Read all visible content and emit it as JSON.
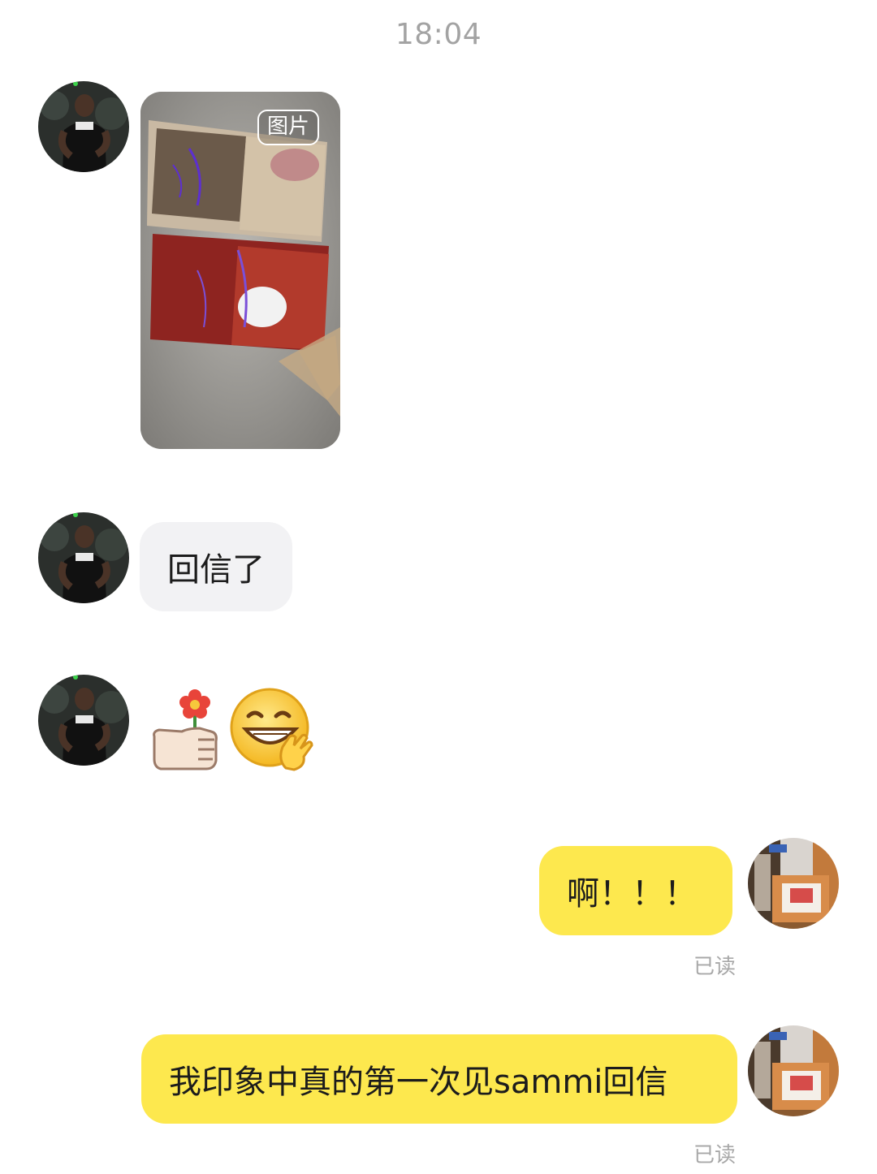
{
  "chat": {
    "timestamp": "18:04",
    "messages": [
      {
        "side": "in",
        "type": "image",
        "tag": "图片"
      },
      {
        "side": "in",
        "type": "text",
        "text": "回信了"
      },
      {
        "side": "in",
        "type": "stickers",
        "icons": [
          "thumb-flower-icon",
          "grin-wave-emoji-icon"
        ]
      },
      {
        "side": "out",
        "type": "text",
        "text": "啊！！！",
        "status": "已读"
      },
      {
        "side": "out",
        "type": "text",
        "text": "我印象中真的第一次见sammi回信",
        "status": "已读"
      }
    ]
  },
  "colors": {
    "incoming_bubble": "#f2f2f4",
    "outgoing_bubble": "#fde84e",
    "timestamp_text": "#a3a3a3",
    "read_text": "#a8a8a8"
  }
}
